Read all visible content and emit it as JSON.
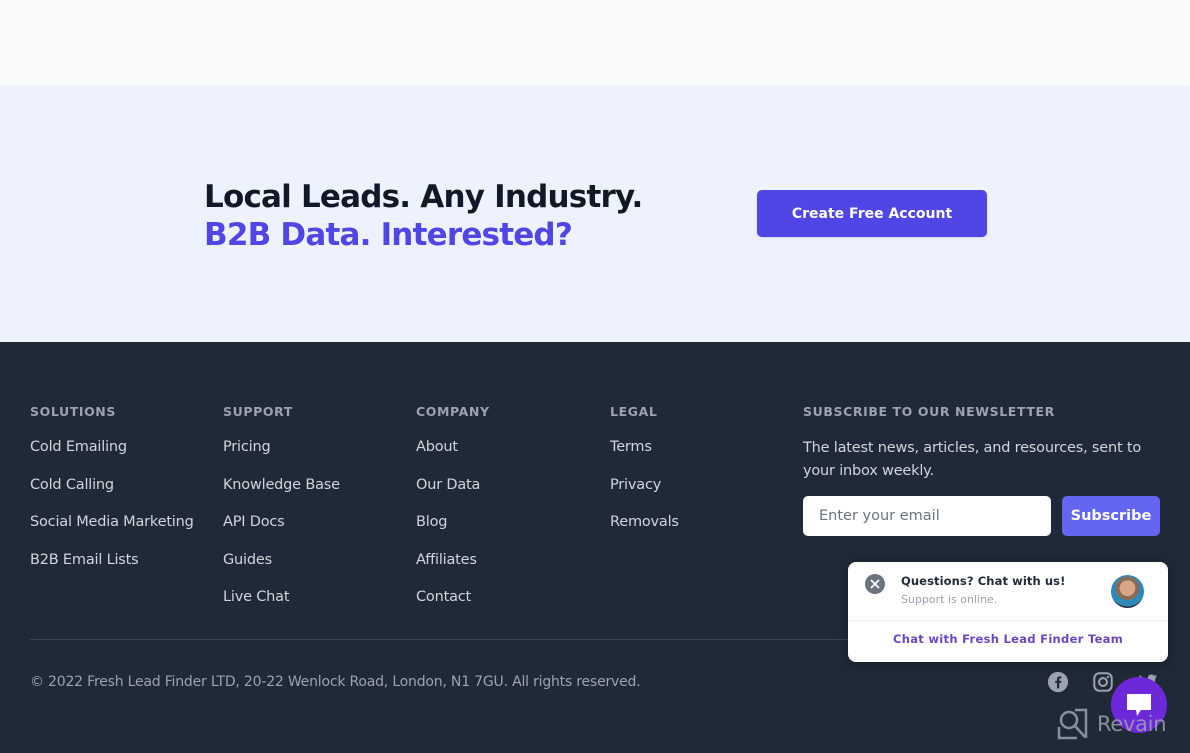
{
  "cta": {
    "line1": "Local Leads. Any Industry.",
    "line2": "B2B Data. Interested?",
    "button_label": "Create Free Account"
  },
  "footer": {
    "columns": [
      {
        "heading": "Solutions",
        "links": [
          "Cold Emailing",
          "Cold Calling",
          "Social Media Marketing",
          "B2B Email Lists"
        ]
      },
      {
        "heading": "Support",
        "links": [
          "Pricing",
          "Knowledge Base",
          "API Docs",
          "Guides",
          "Live Chat"
        ]
      },
      {
        "heading": "Company",
        "links": [
          "About",
          "Our Data",
          "Blog",
          "Affiliates",
          "Contact"
        ]
      },
      {
        "heading": "Legal",
        "links": [
          "Terms",
          "Privacy",
          "Removals"
        ]
      }
    ],
    "newsletter": {
      "heading": "Subscribe to our newsletter",
      "description": "The latest news, articles, and resources, sent to your inbox weekly.",
      "email_placeholder": "Enter your email",
      "email_value": "",
      "button_label": "Subscribe"
    },
    "copyright": "© 2022 Fresh Lead Finder LTD, 20-22 Wenlock Road, London, N1 7GU. All rights reserved.",
    "social": [
      "facebook-icon",
      "instagram-icon",
      "twitter-icon"
    ]
  },
  "chat_widget": {
    "title": "Questions? Chat with us!",
    "status": "Support is online.",
    "link_label": "Chat with Fresh Lead Finder Team"
  },
  "watermark": {
    "text": "Revain"
  },
  "colors": {
    "brand_primary": "#4f46e5",
    "subscribe_button": "#6366f1",
    "footer_bg": "#1f2937",
    "cta_bg": "#eef2ff",
    "chat_accent": "#6d28d9"
  }
}
